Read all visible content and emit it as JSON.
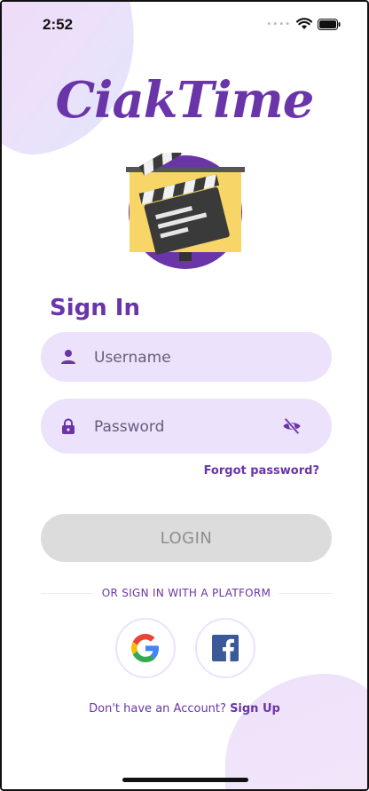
{
  "status_bar": {
    "time": "2:52",
    "icons": [
      "cellular-dots-icon",
      "wifi-icon",
      "battery-icon"
    ]
  },
  "app": {
    "logo_text": "CiakTime",
    "logo_icon": "clapperboard-icon"
  },
  "signin": {
    "title": "Sign In",
    "username_placeholder": "Username",
    "username_value": "",
    "password_placeholder": "Password",
    "password_value": "",
    "forgot_label": "Forgot password?",
    "login_label": "LOGIN",
    "platform_divider": "OR SIGN IN WITH A PLATFORM",
    "social_buttons": [
      "google-icon",
      "facebook-icon"
    ],
    "no_account_text": "Don't have an Account?",
    "signup_label": "Sign Up"
  },
  "colors": {
    "brand_purple": "#6a35a8",
    "field_background": "#ece2fb",
    "login_disabled": "#dcdcdc",
    "clapper_yellow": "#f7d567"
  }
}
